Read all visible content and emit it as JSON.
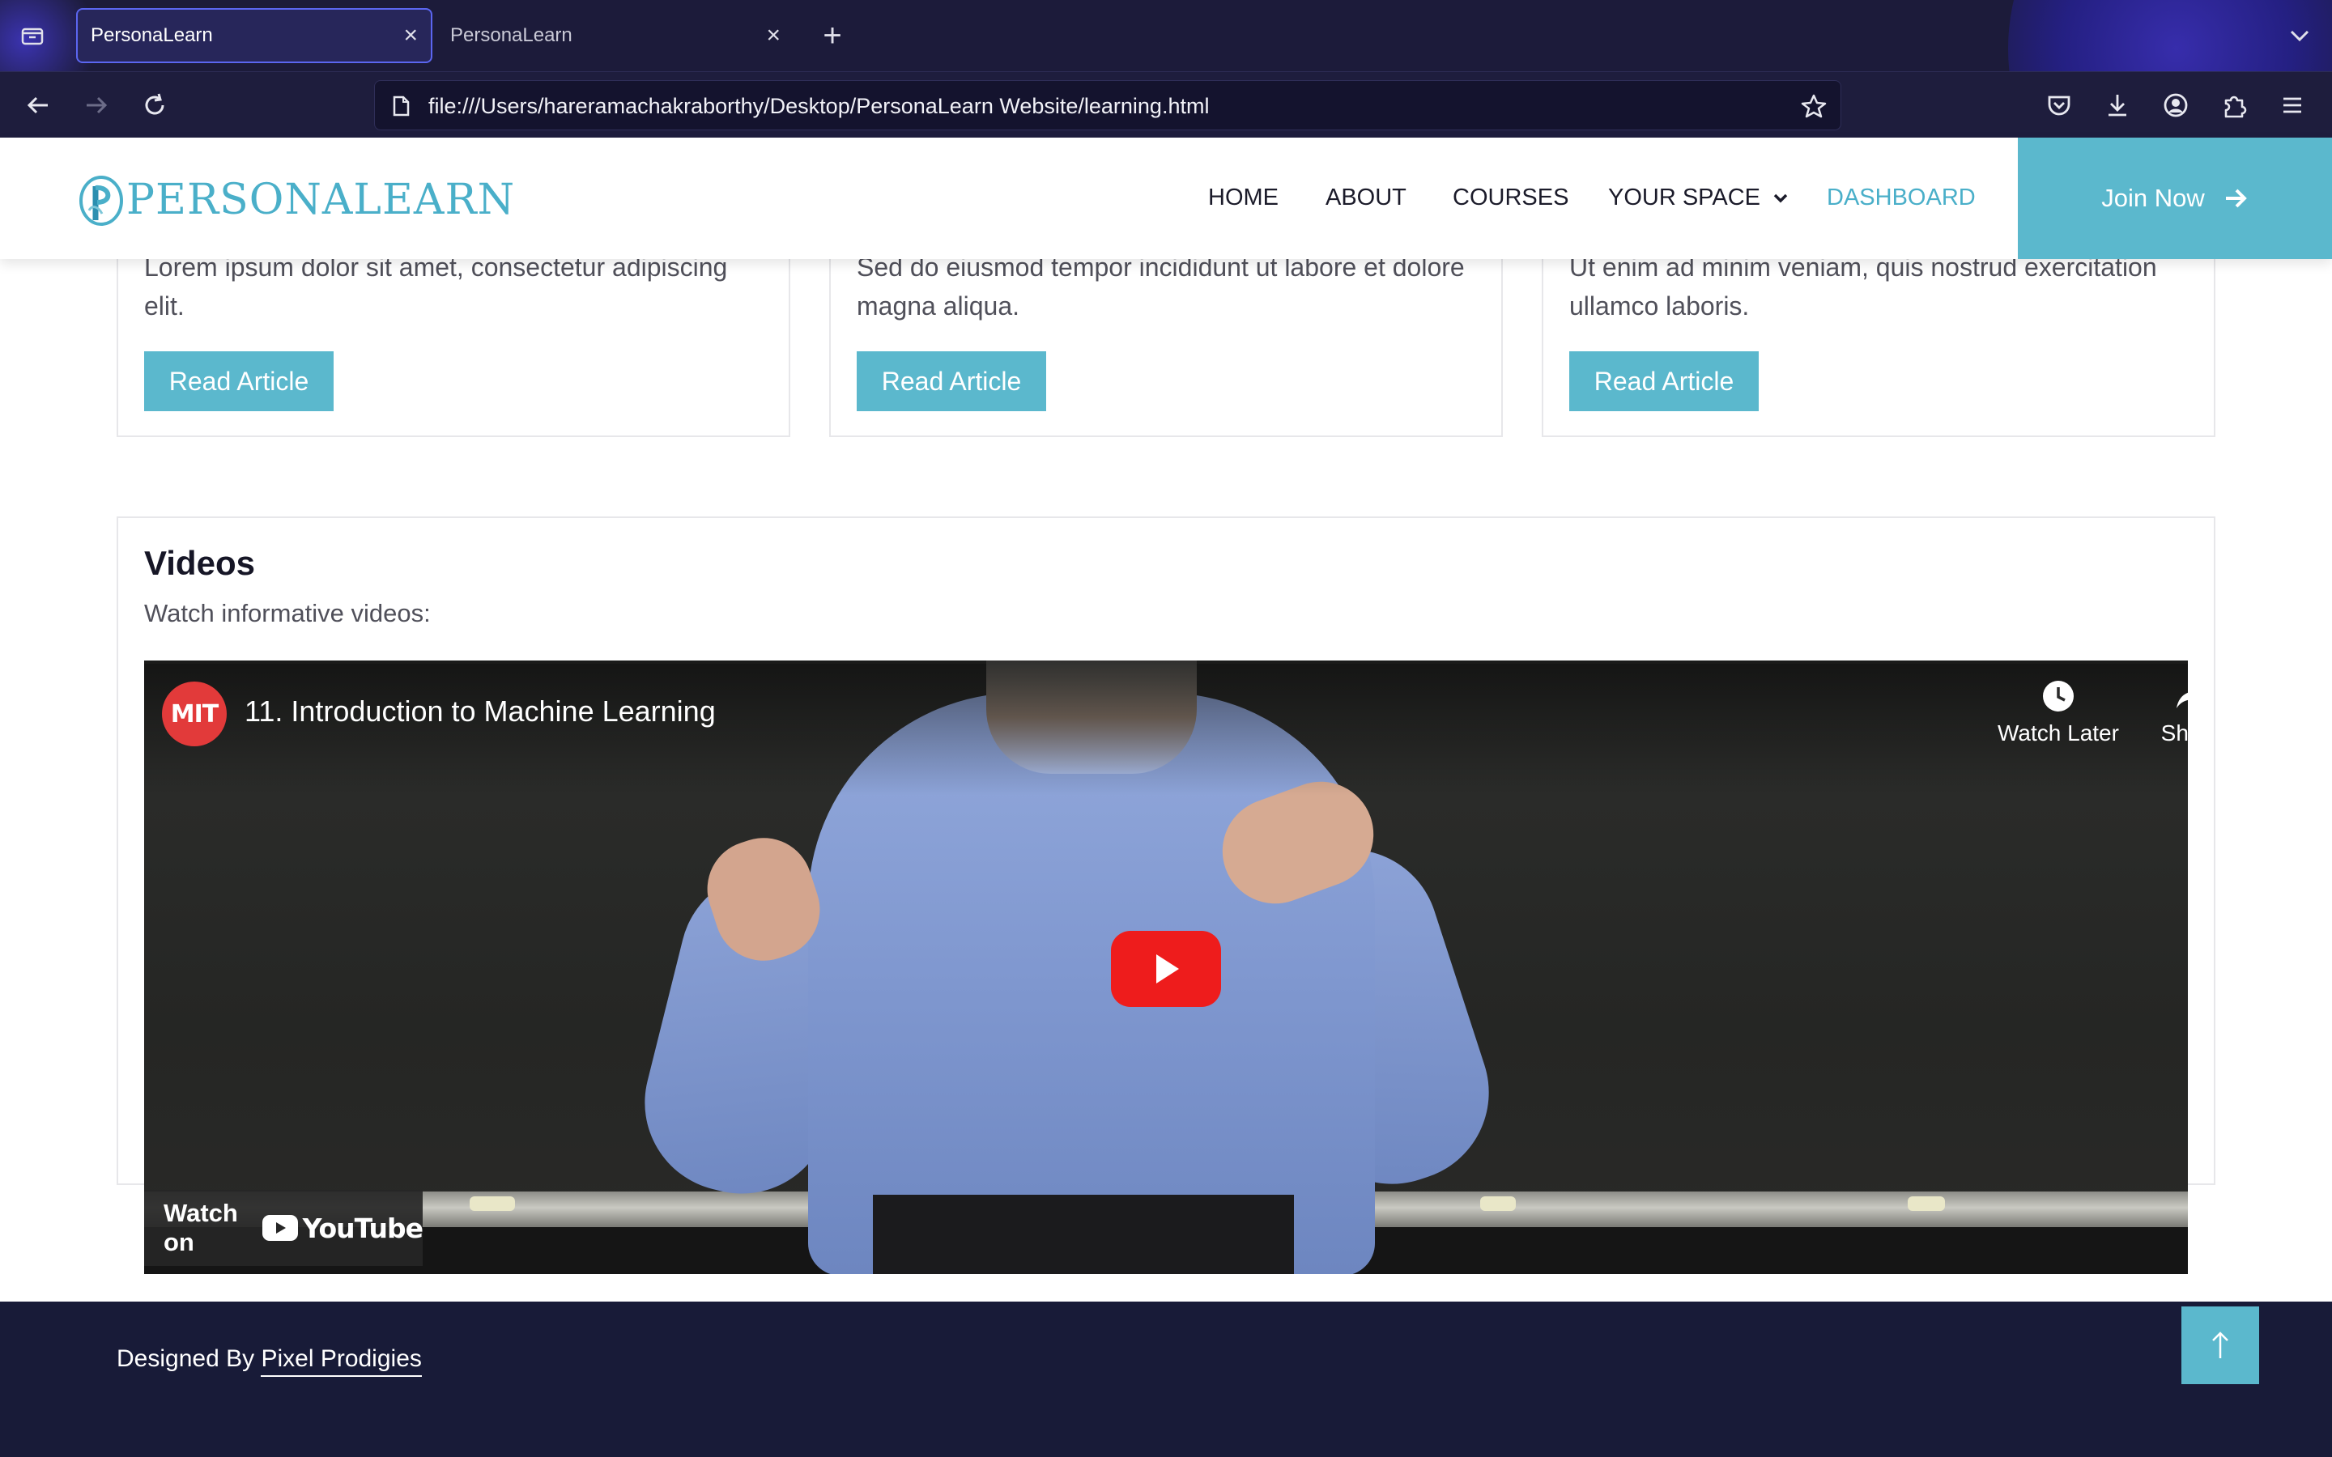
{
  "browser": {
    "tabs": [
      {
        "label": "PersonaLearn",
        "active": true
      },
      {
        "label": "PersonaLearn",
        "active": false
      }
    ],
    "url": "file:///Users/hareramachakraborthy/Desktop/PersonaLearn Website/learning.html"
  },
  "site": {
    "logo_text": "PERSONALEARN",
    "nav": {
      "home": "HOME",
      "about": "ABOUT",
      "courses": "COURSES",
      "your_space": "YOUR SPACE",
      "dashboard": "DASHBOARD"
    },
    "join_label": "Join Now",
    "accent_color": "#5bb8cd"
  },
  "articles": [
    {
      "text": "Lorem ipsum dolor sit amet, consectetur adipiscing elit.",
      "button": "Read Article"
    },
    {
      "text": "Sed do eiusmod tempor incididunt ut labore et dolore magna aliqua.",
      "button": "Read Article"
    },
    {
      "text": "Ut enim ad minim veniam, quis nostrud exercitation ullamco laboris.",
      "button": "Read Article"
    }
  ],
  "videos": {
    "title": "Videos",
    "subtitle": "Watch informative videos:",
    "player": {
      "channel_badge": "MIT",
      "title": "11. Introduction to Machine Learning",
      "watch_later": "Watch Later",
      "share": "Share",
      "watch_on": "Watch on",
      "youtube": "YouTube"
    }
  },
  "footer": {
    "designed_by": "Designed By",
    "author": "Pixel Prodigies"
  }
}
